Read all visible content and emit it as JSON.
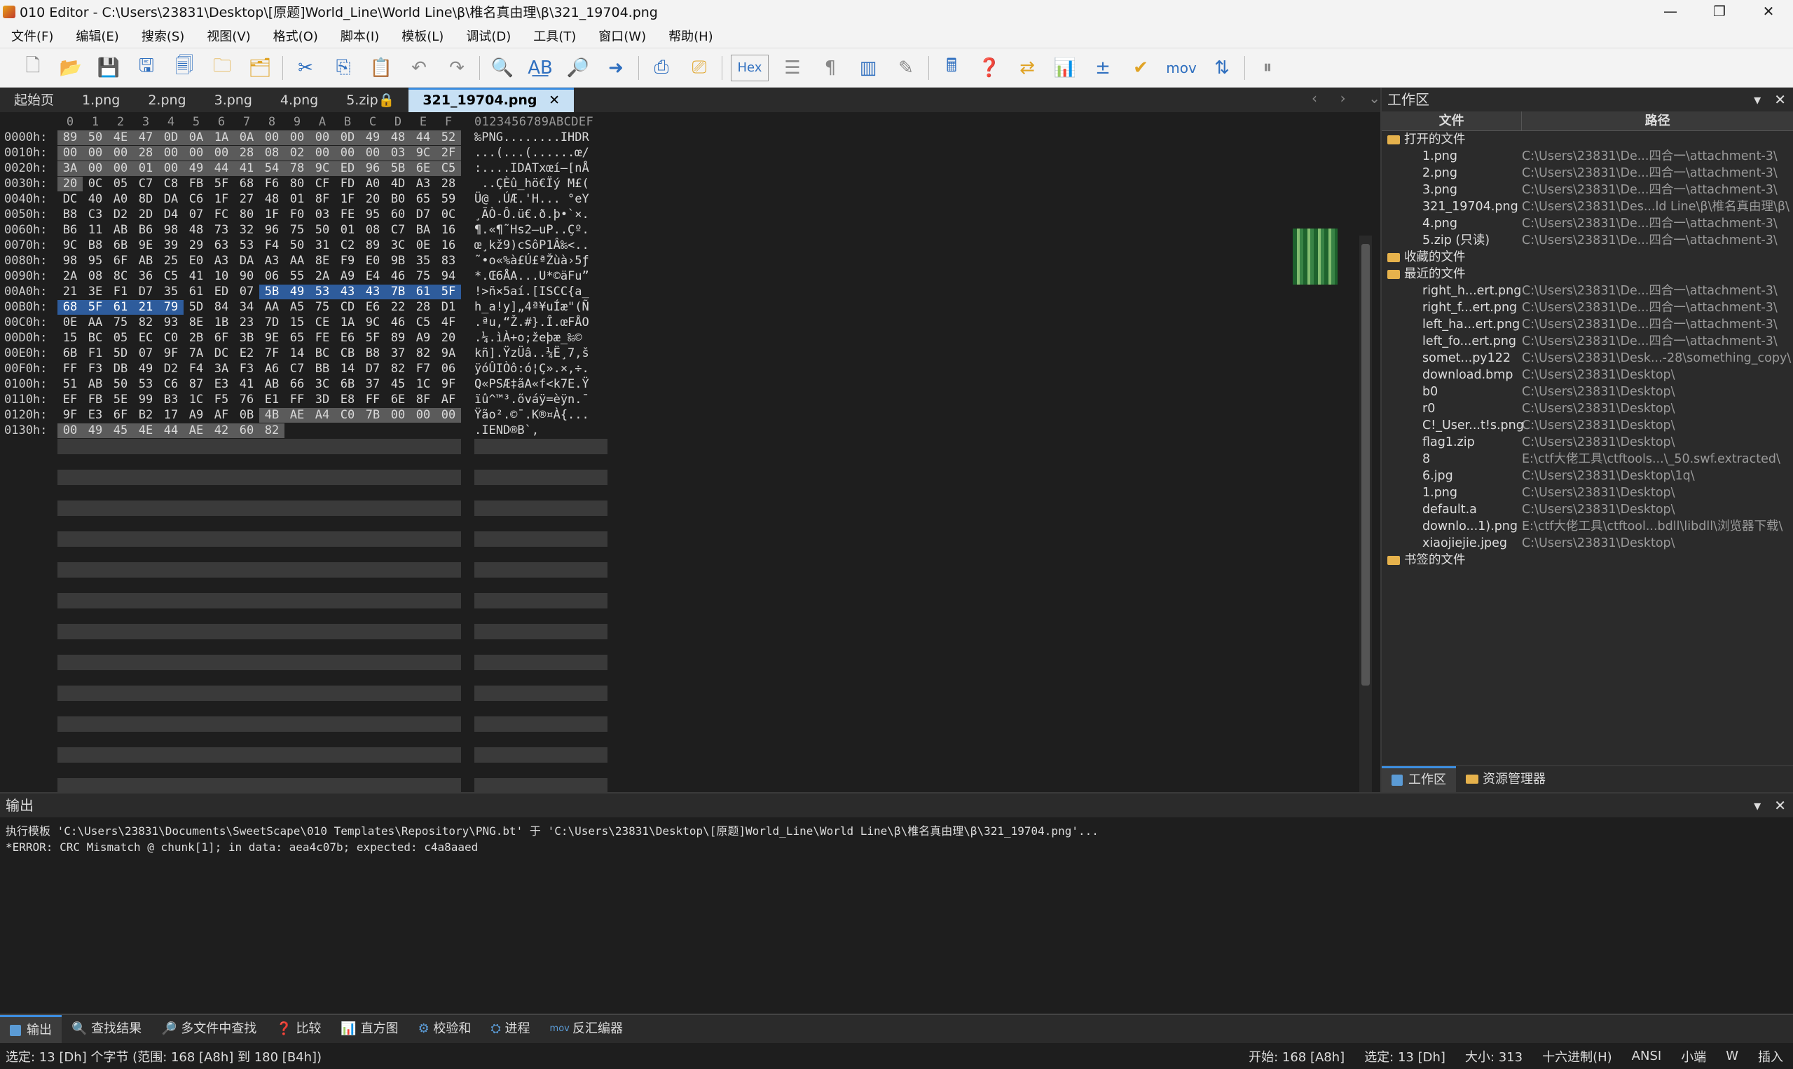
{
  "window": {
    "title": "010 Editor - C:\\Users\\23831\\Desktop\\[原题]World_Line\\World Line\\β\\椎名真由理\\β\\321_19704.png",
    "minimize": "—",
    "maximize": "❐",
    "close": "✕"
  },
  "menu": [
    "文件(F)",
    "编辑(E)",
    "搜索(S)",
    "视图(V)",
    "格式(O)",
    "脚本(I)",
    "模板(L)",
    "调试(D)",
    "工具(T)",
    "窗口(W)",
    "帮助(H)"
  ],
  "toolbar": {
    "hex_label": "Hex",
    "mov_label": "mov"
  },
  "tabs": [
    {
      "label": "起始页"
    },
    {
      "label": "1.png"
    },
    {
      "label": "2.png"
    },
    {
      "label": "3.png"
    },
    {
      "label": "4.png"
    },
    {
      "label": "5.zip🔒"
    },
    {
      "label": "321_19704.png",
      "close": "✕"
    }
  ],
  "hex": {
    "col_headers": [
      "0",
      "1",
      "2",
      "3",
      "4",
      "5",
      "6",
      "7",
      "8",
      "9",
      "A",
      "B",
      "C",
      "D",
      "E",
      "F"
    ],
    "ascii_header": "0123456789ABCDEF",
    "rows": [
      {
        "addr": "0000h:",
        "bytes": [
          "89",
          "50",
          "4E",
          "47",
          "0D",
          "0A",
          "1A",
          "0A",
          "00",
          "00",
          "00",
          "0D",
          "49",
          "48",
          "44",
          "52"
        ],
        "ascii": "‰PNG........IHDR"
      },
      {
        "addr": "0010h:",
        "bytes": [
          "00",
          "00",
          "00",
          "28",
          "00",
          "00",
          "00",
          "28",
          "08",
          "02",
          "00",
          "00",
          "00",
          "03",
          "9C",
          "2F"
        ],
        "ascii": "...(...(......œ/"
      },
      {
        "addr": "0020h:",
        "bytes": [
          "3A",
          "00",
          "00",
          "01",
          "00",
          "49",
          "44",
          "41",
          "54",
          "78",
          "9C",
          "ED",
          "96",
          "5B",
          "6E",
          "C5"
        ],
        "ascii": ":....IDATxœí–[nÅ"
      },
      {
        "addr": "0030h:",
        "bytes": [
          "20",
          "0C",
          "05",
          "C7",
          "C8",
          "FB",
          "5F",
          "68",
          "F6",
          "80",
          "CF",
          "FD",
          "A0",
          "4D",
          "A3",
          "28"
        ],
        "ascii": " ..ÇÈû_hö€Ïý M£("
      },
      {
        "addr": "0040h:",
        "bytes": [
          "DC",
          "40",
          "A0",
          "8D",
          "DA",
          "C6",
          "1F",
          "27",
          "48",
          "01",
          "8F",
          "1F",
          "20",
          "B0",
          "65",
          "59"
        ],
        "ascii": "Ü@ .ÚÆ.'H... °eY"
      },
      {
        "addr": "0050h:",
        "bytes": [
          "B8",
          "C3",
          "D2",
          "2D",
          "D4",
          "07",
          "FC",
          "80",
          "1F",
          "F0",
          "03",
          "FE",
          "95",
          "60",
          "D7",
          "0C"
        ],
        "ascii": "¸ÃÒ-Ô.ü€.ð.þ•`×."
      },
      {
        "addr": "0060h:",
        "bytes": [
          "B6",
          "11",
          "AB",
          "B6",
          "98",
          "48",
          "73",
          "32",
          "96",
          "75",
          "50",
          "01",
          "08",
          "C7",
          "BA",
          "16"
        ],
        "ascii": "¶.«¶˜Hs2–uP..Çº."
      },
      {
        "addr": "0070h:",
        "bytes": [
          "9C",
          "B8",
          "6B",
          "9E",
          "39",
          "29",
          "63",
          "53",
          "F4",
          "50",
          "31",
          "C2",
          "89",
          "3C",
          "0E",
          "16"
        ],
        "ascii": "œ¸kž9)cSôP1Â‰<.."
      },
      {
        "addr": "0080h:",
        "bytes": [
          "98",
          "95",
          "6F",
          "AB",
          "25",
          "E0",
          "A3",
          "DA",
          "A3",
          "AA",
          "8E",
          "F9",
          "E0",
          "9B",
          "35",
          "83"
        ],
        "ascii": "˜•o«%à£Ú£ªŽùà›5ƒ"
      },
      {
        "addr": "0090h:",
        "bytes": [
          "2A",
          "08",
          "8C",
          "36",
          "C5",
          "41",
          "10",
          "90",
          "06",
          "55",
          "2A",
          "A9",
          "E4",
          "46",
          "75",
          "94"
        ],
        "ascii": "*.Œ6ÅA...U*©äFu”"
      },
      {
        "addr": "00A0h:",
        "bytes": [
          "21",
          "3E",
          "F1",
          "D7",
          "35",
          "61",
          "ED",
          "07",
          "5B",
          "49",
          "53",
          "43",
          "43",
          "7B",
          "61",
          "5F"
        ],
        "ascii": "!>ñ×5aí.[ISCC{a_"
      },
      {
        "addr": "00B0h:",
        "bytes": [
          "68",
          "5F",
          "61",
          "21",
          "79",
          "5D",
          "84",
          "34",
          "AA",
          "A5",
          "75",
          "CD",
          "E6",
          "22",
          "28",
          "D1"
        ],
        "ascii": "h_a!y]„4ª¥uÍæ\"(Ñ"
      },
      {
        "addr": "00C0h:",
        "bytes": [
          "0E",
          "AA",
          "75",
          "82",
          "93",
          "8E",
          "1B",
          "23",
          "7D",
          "15",
          "CE",
          "1A",
          "9C",
          "46",
          "C5",
          "4F"
        ],
        "ascii": ".ªu‚“Ž.#}.Î.œFÅO"
      },
      {
        "addr": "00D0h:",
        "bytes": [
          "15",
          "BC",
          "05",
          "EC",
          "C0",
          "2B",
          "6F",
          "3B",
          "9E",
          "65",
          "FE",
          "E6",
          "5F",
          "89",
          "A9",
          "20"
        ],
        "ascii": ".¼.ìÀ+o;žeþæ_‰© "
      },
      {
        "addr": "00E0h:",
        "bytes": [
          "6B",
          "F1",
          "5D",
          "07",
          "9F",
          "7A",
          "DC",
          "E2",
          "7F",
          "14",
          "BC",
          "CB",
          "B8",
          "37",
          "82",
          "9A"
        ],
        "ascii": "kñ].ŸzÜâ..¼Ë¸7‚š"
      },
      {
        "addr": "00F0h:",
        "bytes": [
          "FF",
          "F3",
          "DB",
          "49",
          "D2",
          "F4",
          "3A",
          "F3",
          "A6",
          "C7",
          "BB",
          "14",
          "D7",
          "82",
          "F7",
          "06"
        ],
        "ascii": "ÿóÛIÒô:ó¦Ç».×‚÷."
      },
      {
        "addr": "0100h:",
        "bytes": [
          "51",
          "AB",
          "50",
          "53",
          "C6",
          "87",
          "E3",
          "41",
          "AB",
          "66",
          "3C",
          "6B",
          "37",
          "45",
          "1C",
          "9F"
        ],
        "ascii": "Q«PSÆ‡ãA«f<k7E.Ÿ"
      },
      {
        "addr": "0110h:",
        "bytes": [
          "EF",
          "FB",
          "5E",
          "99",
          "B3",
          "1C",
          "F5",
          "76",
          "E1",
          "FF",
          "3D",
          "E8",
          "FF",
          "6E",
          "8F",
          "AF"
        ],
        "ascii": "ïû^™³.õváÿ=èÿn.¯"
      },
      {
        "addr": "0120h:",
        "bytes": [
          "9F",
          "E3",
          "6F",
          "B2",
          "17",
          "A9",
          "AF",
          "0B",
          "4B",
          "AE",
          "A4",
          "C0",
          "7B",
          "00",
          "00",
          "00"
        ],
        "ascii": "Ÿão².©¯.K®¤À{..."
      },
      {
        "addr": "0130h:",
        "bytes": [
          "00",
          "49",
          "45",
          "4E",
          "44",
          "AE",
          "42",
          "60",
          "82"
        ],
        "ascii": ".IEND®B`‚"
      }
    ]
  },
  "workspace": {
    "title": "工作区",
    "col_file": "文件",
    "col_path": "路径",
    "groups": [
      {
        "label": "打开的文件",
        "items": [
          {
            "file": "1.png",
            "path": "C:\\Users\\23831\\De...四合一\\attachment-3\\"
          },
          {
            "file": "2.png",
            "path": "C:\\Users\\23831\\De...四合一\\attachment-3\\"
          },
          {
            "file": "3.png",
            "path": "C:\\Users\\23831\\De...四合一\\attachment-3\\"
          },
          {
            "file": "321_19704.png",
            "path": "C:\\Users\\23831\\Des...ld Line\\β\\椎名真由理\\β\\"
          },
          {
            "file": "4.png",
            "path": "C:\\Users\\23831\\De...四合一\\attachment-3\\"
          },
          {
            "file": "5.zip (只读)",
            "path": "C:\\Users\\23831\\De...四合一\\attachment-3\\"
          }
        ]
      },
      {
        "label": "收藏的文件",
        "items": []
      },
      {
        "label": "最近的文件",
        "items": [
          {
            "file": "right_h...ert.png",
            "path": "C:\\Users\\23831\\De...四合一\\attachment-3\\"
          },
          {
            "file": "right_f...ert.png",
            "path": "C:\\Users\\23831\\De...四合一\\attachment-3\\"
          },
          {
            "file": "left_ha...ert.png",
            "path": "C:\\Users\\23831\\De...四合一\\attachment-3\\"
          },
          {
            "file": "left_fo...ert.png",
            "path": "C:\\Users\\23831\\De...四合一\\attachment-3\\"
          },
          {
            "file": "somet...py122",
            "path": "C:\\Users\\23831\\Desk...-28\\something_copy\\"
          },
          {
            "file": "download.bmp",
            "path": "C:\\Users\\23831\\Desktop\\"
          },
          {
            "file": "b0",
            "path": "C:\\Users\\23831\\Desktop\\"
          },
          {
            "file": "r0",
            "path": "C:\\Users\\23831\\Desktop\\"
          },
          {
            "file": "C!_User...t!s.png",
            "path": "C:\\Users\\23831\\Desktop\\"
          },
          {
            "file": "flag1.zip",
            "path": "C:\\Users\\23831\\Desktop\\"
          },
          {
            "file": "8",
            "path": "E:\\ctf大佬工具\\ctftools...\\_50.swf.extracted\\"
          },
          {
            "file": "6.jpg",
            "path": "C:\\Users\\23831\\Desktop\\1q\\"
          },
          {
            "file": "1.png",
            "path": "C:\\Users\\23831\\Desktop\\"
          },
          {
            "file": "default.a",
            "path": "C:\\Users\\23831\\Desktop\\"
          },
          {
            "file": "downlo...1).png",
            "path": "E:\\ctf大佬工具\\ctftool...bdll\\libdll\\浏览器下载\\"
          },
          {
            "file": "xiaojiejie.jpeg",
            "path": "C:\\Users\\23831\\Desktop\\"
          }
        ]
      },
      {
        "label": "书签的文件",
        "items": []
      }
    ],
    "tabs": [
      "工作区",
      "资源管理器"
    ]
  },
  "output": {
    "title": "输出",
    "lines": [
      "执行模板 'C:\\Users\\23831\\Documents\\SweetScape\\010 Templates\\Repository\\PNG.bt' 于 'C:\\Users\\23831\\Desktop\\[原题]World_Line\\World Line\\β\\椎名真由理\\β\\321_19704.png'...",
      "*ERROR: CRC Mismatch @ chunk[1]; in data: aea4c07b; expected: c4a8aaed"
    ]
  },
  "bottom_tabs": [
    "输出",
    "查找结果",
    "多文件中查找",
    "比较",
    "直方图",
    "校验和",
    "进程",
    "反汇编器"
  ],
  "status": {
    "left": "选定: 13 [Dh] 个字节 (范围: 168 [A8h] 到 180 [B4h])",
    "start": "开始: 168 [A8h]",
    "selected": "选定: 13 [Dh]",
    "size": "大小: 313",
    "mode": "十六进制(H)",
    "encoding": "ANSI",
    "endian": "小端",
    "w": "W",
    "insert": "插入"
  }
}
